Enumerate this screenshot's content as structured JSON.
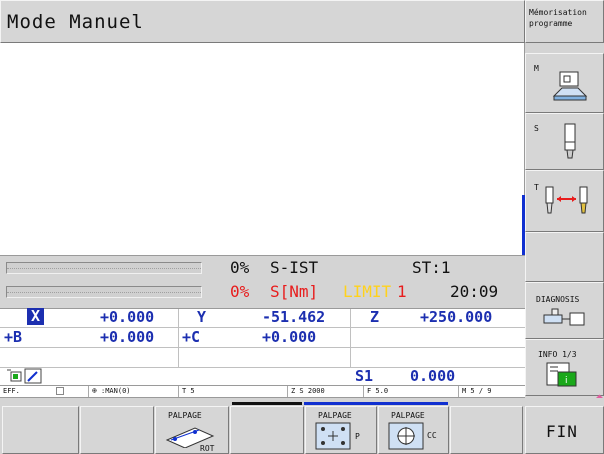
{
  "header": {
    "mode_title": "Mode Manuel",
    "side_title": "Mémorisation programme"
  },
  "status": {
    "spindle_pct": "0%",
    "spindle_label": "S-IST",
    "stage": "ST:1",
    "torque_pct": "0%",
    "torque_label": "S[Nm]",
    "limit_word": "LIMIT",
    "limit_num": "1",
    "time": "20:09"
  },
  "axes": {
    "x": {
      "label": "X",
      "value": "+0.000"
    },
    "y": {
      "label": "Y",
      "value": "-51.462"
    },
    "z": {
      "label": "Z",
      "value": "+250.000"
    },
    "b": {
      "label": "+B",
      "value": "+0.000"
    },
    "c": {
      "label": "+C",
      "value": "+0.000"
    }
  },
  "spindle_row": {
    "label": "S1",
    "value": "0.000"
  },
  "info_bar": {
    "eff": "EFF.",
    "man": ":MAN(0)",
    "tool": "T 5",
    "z_s": "Z S 2000",
    "feed": "F 5.0",
    "m": "M 5 / 9"
  },
  "right_softkeys": {
    "m": "M",
    "s": "S",
    "t": "T",
    "diagnosis": "DIAGNOSIS",
    "info": "INFO 1/3"
  },
  "bottom_softkeys": {
    "palpage1": "PALPAGE",
    "rot": "ROT",
    "palpage2": "PALPAGE",
    "p": "P",
    "palpage3": "PALPAGE",
    "cc": "CC",
    "fin": "FIN"
  },
  "colors": {
    "axis_blue": "#1c2fb0",
    "limit_yellow": "#ffd21c",
    "torque_red": "#e81c1c",
    "accent_blue": "#1030d0"
  }
}
